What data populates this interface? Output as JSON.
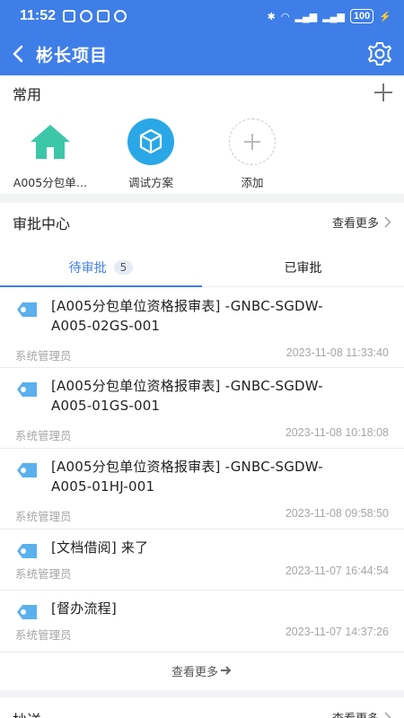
{
  "status": {
    "time": "11:52",
    "battery": "100"
  },
  "appbar": {
    "title": "彬长项目"
  },
  "common": {
    "title": "常用",
    "shortcuts": [
      {
        "label": "A005分包单…",
        "icon": "home-icon"
      },
      {
        "label": "调试方案",
        "icon": "cube-icon"
      },
      {
        "label": "添加",
        "icon": "add-icon"
      }
    ]
  },
  "approval": {
    "title": "审批中心",
    "more_label": "查看更多",
    "tabs": [
      {
        "label": "待审批",
        "count": "5"
      },
      {
        "label": "已审批"
      }
    ],
    "items": [
      {
        "title_line1": "[A005分包单位资格报审表] -GNBC-SGDW-",
        "title_line2": "A005-02GS-001",
        "user": "系统管理员",
        "time": "2023-11-08 11:33:40"
      },
      {
        "title_line1": "[A005分包单位资格报审表] -GNBC-SGDW-",
        "title_line2": "A005-01GS-001",
        "user": "系统管理员",
        "time": "2023-11-08 10:18:08"
      },
      {
        "title_line1": "[A005分包单位资格报审表] -GNBC-SGDW-",
        "title_line2": "A005-01HJ-001",
        "user": "系统管理员",
        "time": "2023-11-08 09:58:50"
      },
      {
        "title_line1": "[文档借阅] 来了",
        "user": "系统管理员",
        "time": "2023-11-07 16:44:54"
      },
      {
        "title_line1": "[督办流程]",
        "user": "系统管理员",
        "time": "2023-11-07 14:37:26"
      }
    ],
    "footer_more": "查看更多"
  },
  "cc": {
    "title": "抄送",
    "more_label": "查看更多"
  },
  "colors": {
    "primary": "#3f7ee8",
    "home": "#3cc7a8",
    "cube": "#2aa7e6",
    "tag": "#5bb0ee"
  }
}
